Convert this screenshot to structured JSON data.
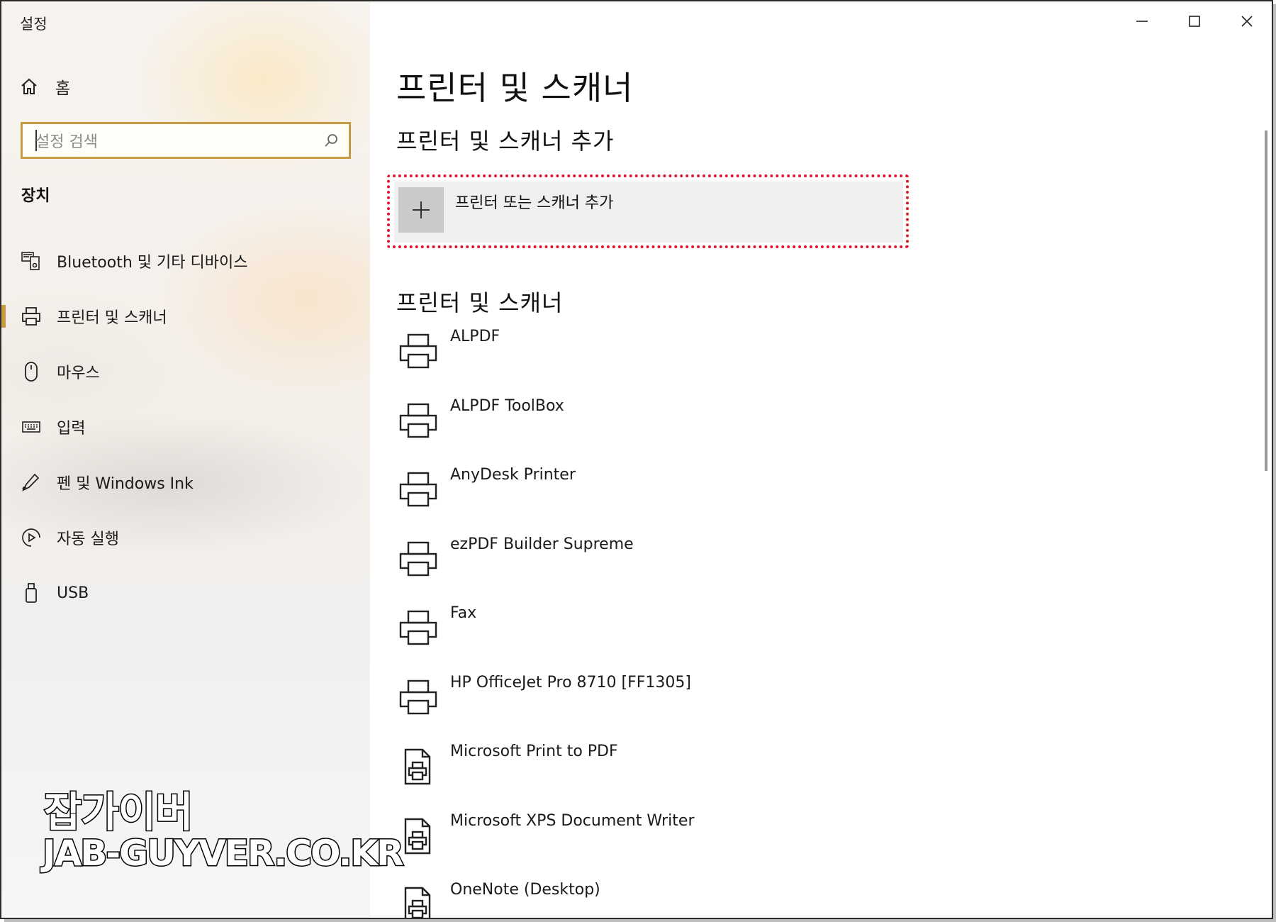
{
  "window": {
    "title": "설정",
    "controls": [
      "minimize",
      "maximize",
      "close"
    ]
  },
  "sidebar": {
    "home_label": "홈",
    "search_placeholder": "설정 검색",
    "section_label": "장치",
    "items": [
      {
        "label": "Bluetooth 및 기타 디바이스",
        "icon": "bluetooth-devices-icon",
        "active": false
      },
      {
        "label": "프린터 및 스캐너",
        "icon": "printer-icon",
        "active": true
      },
      {
        "label": "마우스",
        "icon": "mouse-icon",
        "active": false
      },
      {
        "label": "입력",
        "icon": "keyboard-icon",
        "active": false
      },
      {
        "label": "펜 및 Windows Ink",
        "icon": "pen-icon",
        "active": false
      },
      {
        "label": "자동 실행",
        "icon": "autoplay-icon",
        "active": false
      },
      {
        "label": "USB",
        "icon": "usb-icon",
        "active": false
      }
    ]
  },
  "main": {
    "page_title": "프린터 및 스캐너",
    "add_section_title": "프린터 및 스캐너 추가",
    "add_button_label": "프린터 또는 스캐너 추가",
    "list_title": "프린터 및 스캐너",
    "printers": [
      {
        "name": "ALPDF",
        "icon": "printer-icon"
      },
      {
        "name": "ALPDF ToolBox",
        "icon": "printer-icon"
      },
      {
        "name": "AnyDesk Printer",
        "icon": "printer-icon"
      },
      {
        "name": "ezPDF Builder Supreme",
        "icon": "printer-icon"
      },
      {
        "name": "Fax",
        "icon": "printer-icon"
      },
      {
        "name": "HP OfficeJet Pro 8710 [FF1305]",
        "icon": "printer-icon"
      },
      {
        "name": "Microsoft Print to PDF",
        "icon": "document-printer-icon"
      },
      {
        "name": "Microsoft XPS Document Writer",
        "icon": "document-printer-icon"
      },
      {
        "name": "OneNote (Desktop)",
        "icon": "document-printer-icon"
      }
    ]
  },
  "watermark": {
    "line1": "잡가이버",
    "line2": "JAB-GUYVER.CO.KR"
  },
  "colors": {
    "accent": "#c79a44",
    "highlight_border": "#e2142a",
    "add_row_bg": "#efefef",
    "plus_tile_bg": "#cacaca"
  }
}
